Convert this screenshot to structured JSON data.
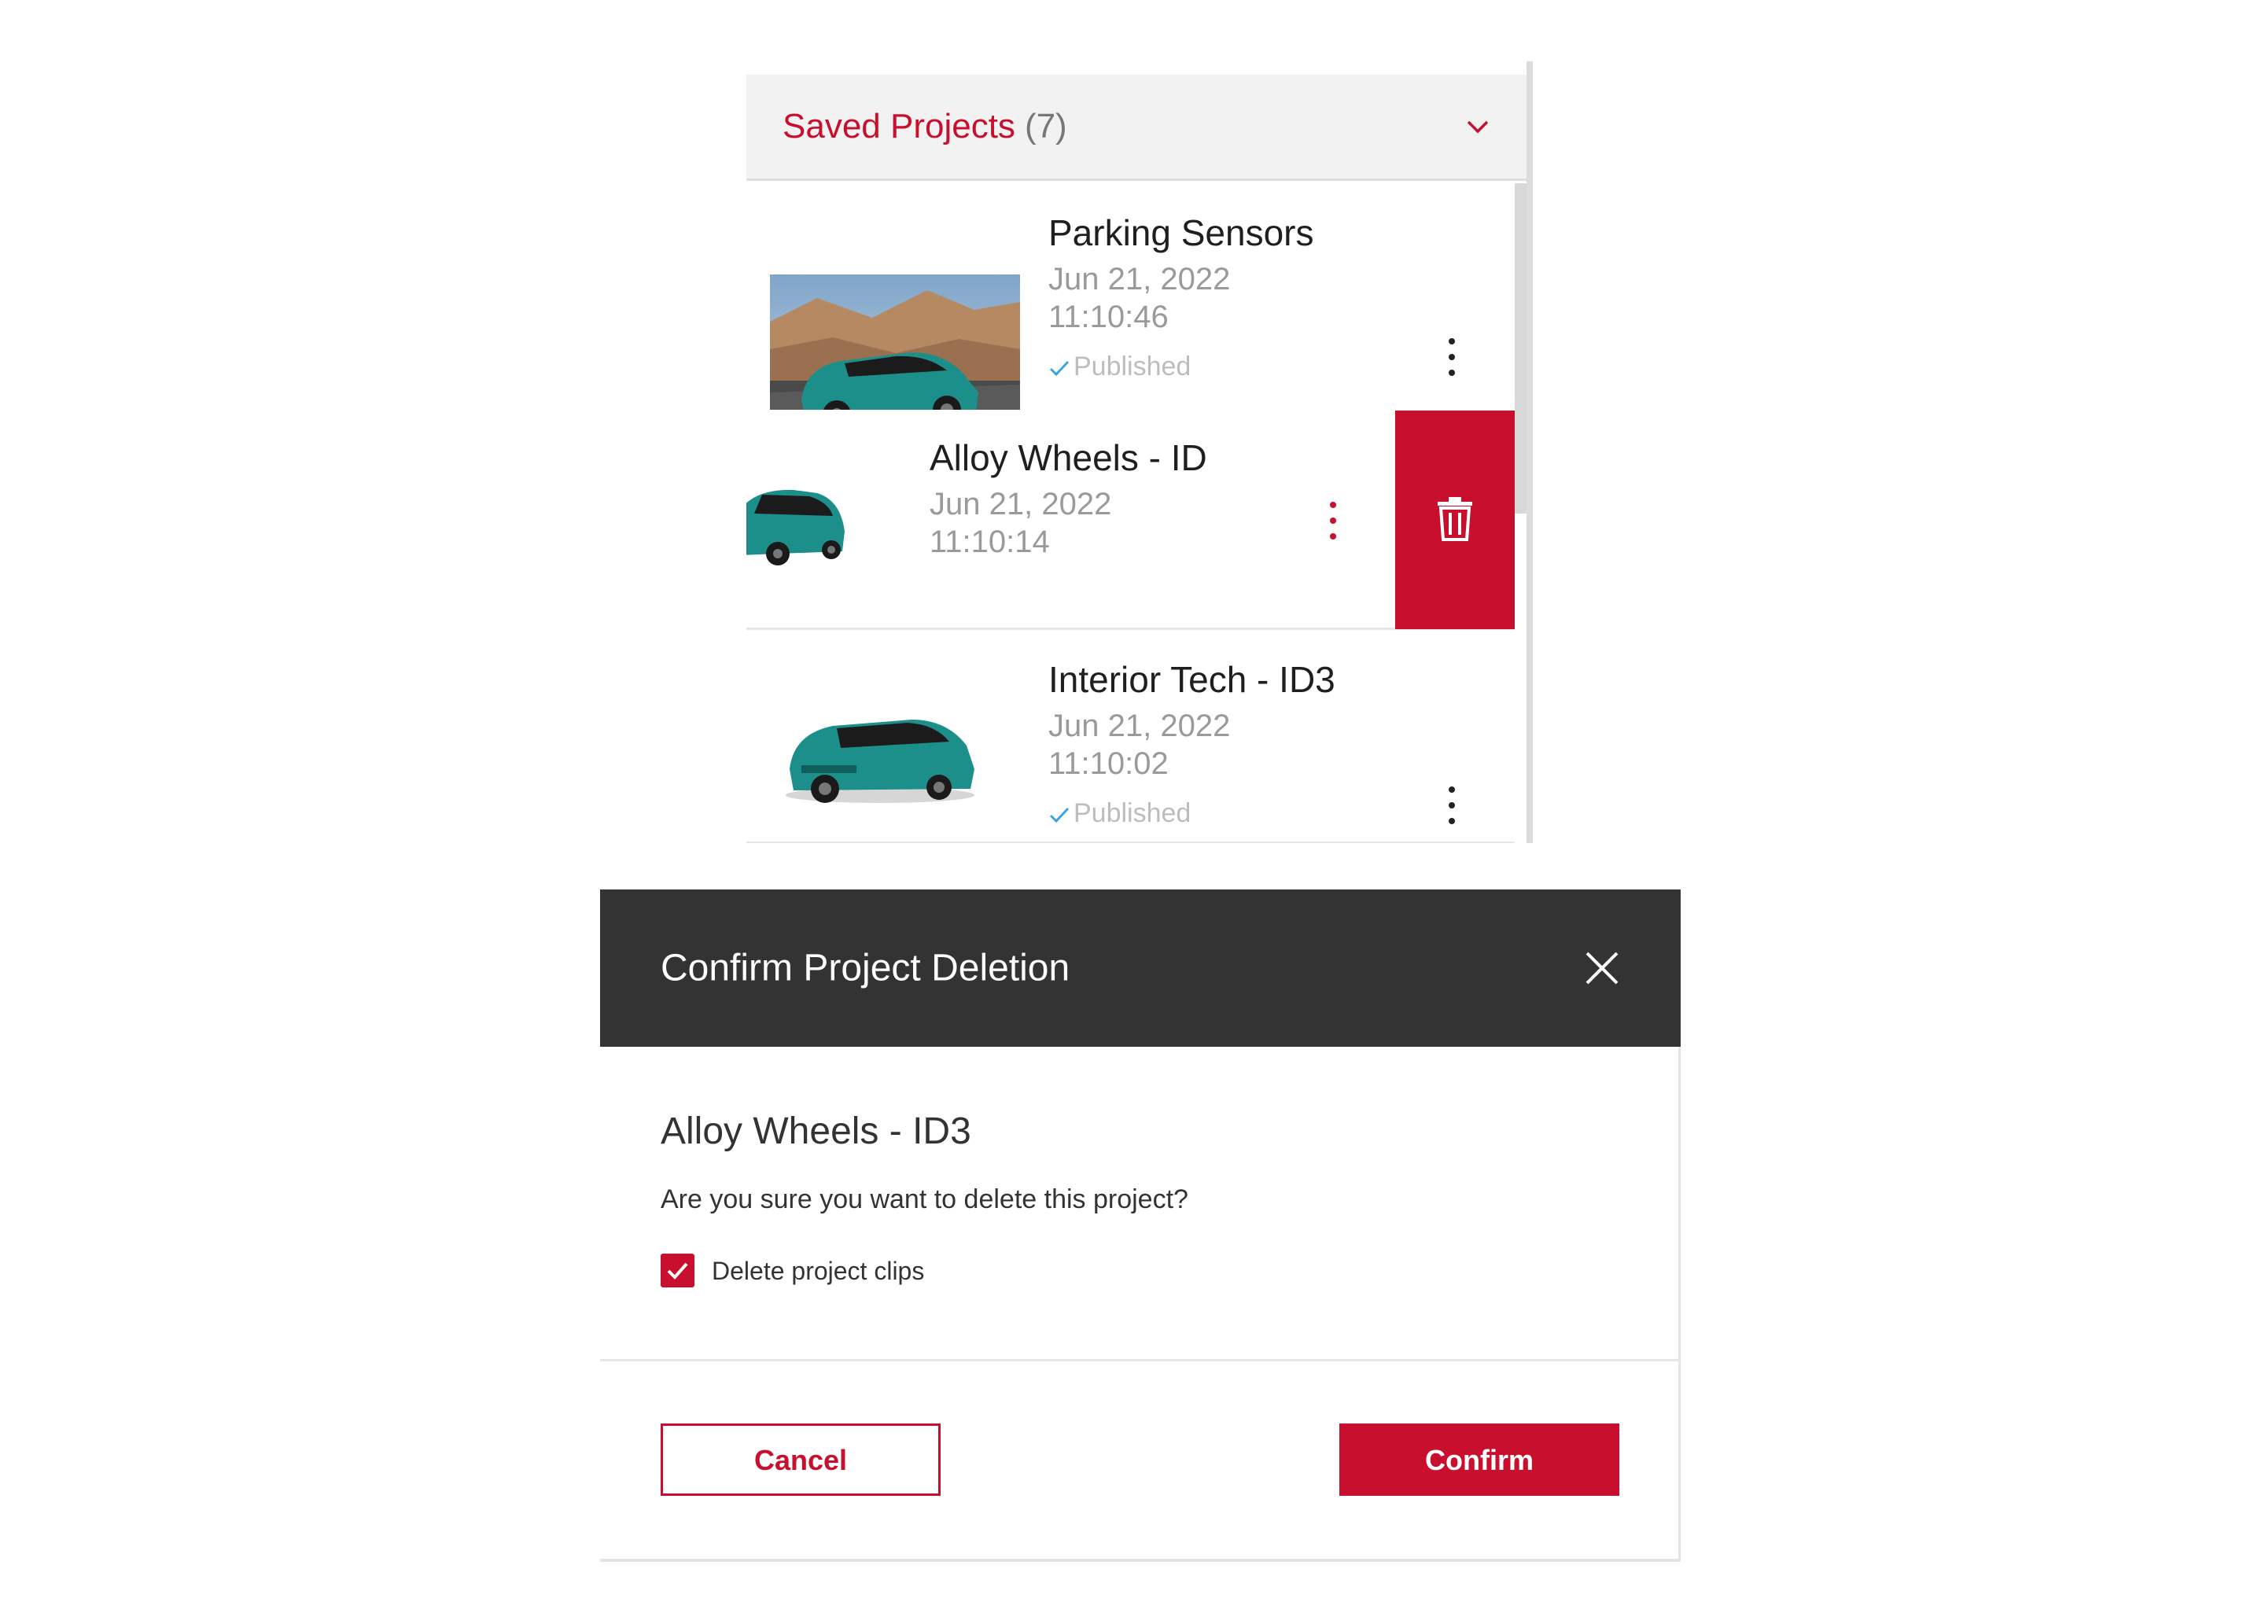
{
  "panel": {
    "title": "Saved Projects",
    "count": "(7)",
    "chevron_icon": "chevron-down-icon",
    "accent_color": "#c8102e",
    "projects": [
      {
        "title": "Parking Sensors",
        "date": "Jun 21, 2022",
        "time": "11:10:46",
        "status": "Published"
      },
      {
        "title": "Alloy Wheels - ID",
        "date": "Jun 21, 2022",
        "time": "11:10:14",
        "status": ""
      },
      {
        "title": "Interior Tech - ID3",
        "date": "Jun 21, 2022",
        "time": "11:10:02",
        "status": "Published"
      }
    ],
    "delete_action_icon": "trash-icon"
  },
  "modal": {
    "title": "Confirm Project Deletion",
    "close_icon": "close-icon",
    "project_name": "Alloy Wheels - ID3",
    "question": "Are you sure you want to delete this project?",
    "checkbox_label": "Delete project clips",
    "checkbox_checked": true,
    "cancel_label": "Cancel",
    "confirm_label": "Confirm",
    "header_color": "#333333"
  }
}
